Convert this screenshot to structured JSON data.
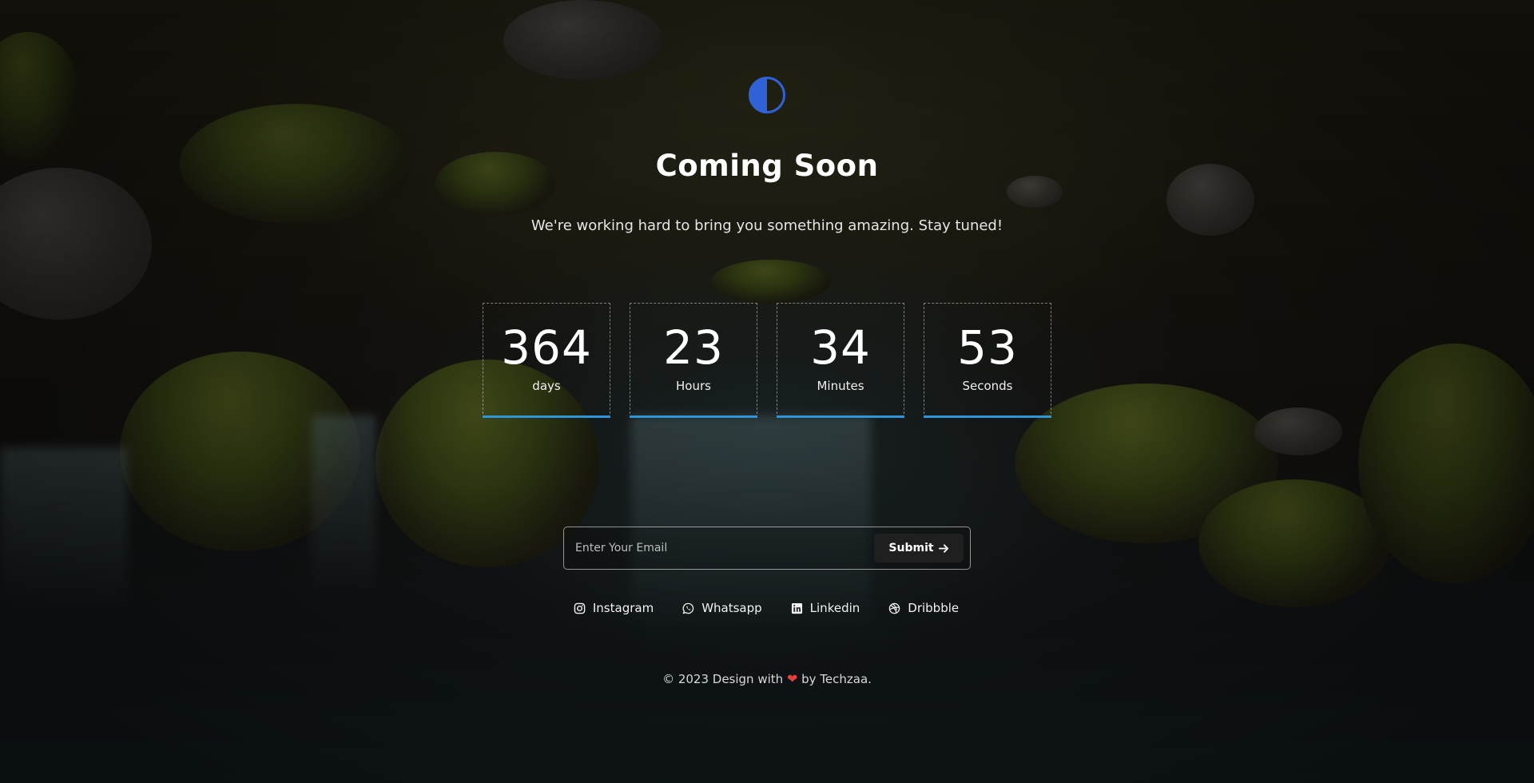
{
  "logo": {
    "icon": "half-circle-icon",
    "color": "#2f62d8"
  },
  "hero": {
    "title": "Coming Soon",
    "subtitle": "We're working hard to bring you something amazing. Stay tuned!"
  },
  "countdown": {
    "bar_color": "#2e96d6",
    "units": [
      {
        "value": "364",
        "label": "days"
      },
      {
        "value": "23",
        "label": "Hours"
      },
      {
        "value": "34",
        "label": "Minutes"
      },
      {
        "value": "53",
        "label": "Seconds"
      }
    ]
  },
  "subscribe": {
    "placeholder": "Enter Your Email",
    "value": "",
    "submit_label": "Submit",
    "submit_icon": "arrow-right-icon"
  },
  "socials": [
    {
      "label": "Instagram",
      "icon": "instagram-icon"
    },
    {
      "label": "Whatsapp",
      "icon": "whatsapp-icon"
    },
    {
      "label": "Linkedin",
      "icon": "linkedin-icon"
    },
    {
      "label": "Dribbble",
      "icon": "dribbble-icon"
    }
  ],
  "footer": {
    "prefix": "© 2023 Design with",
    "heart": "❤",
    "suffix": "by Techzaa.",
    "heart_color": "#e0413f"
  }
}
